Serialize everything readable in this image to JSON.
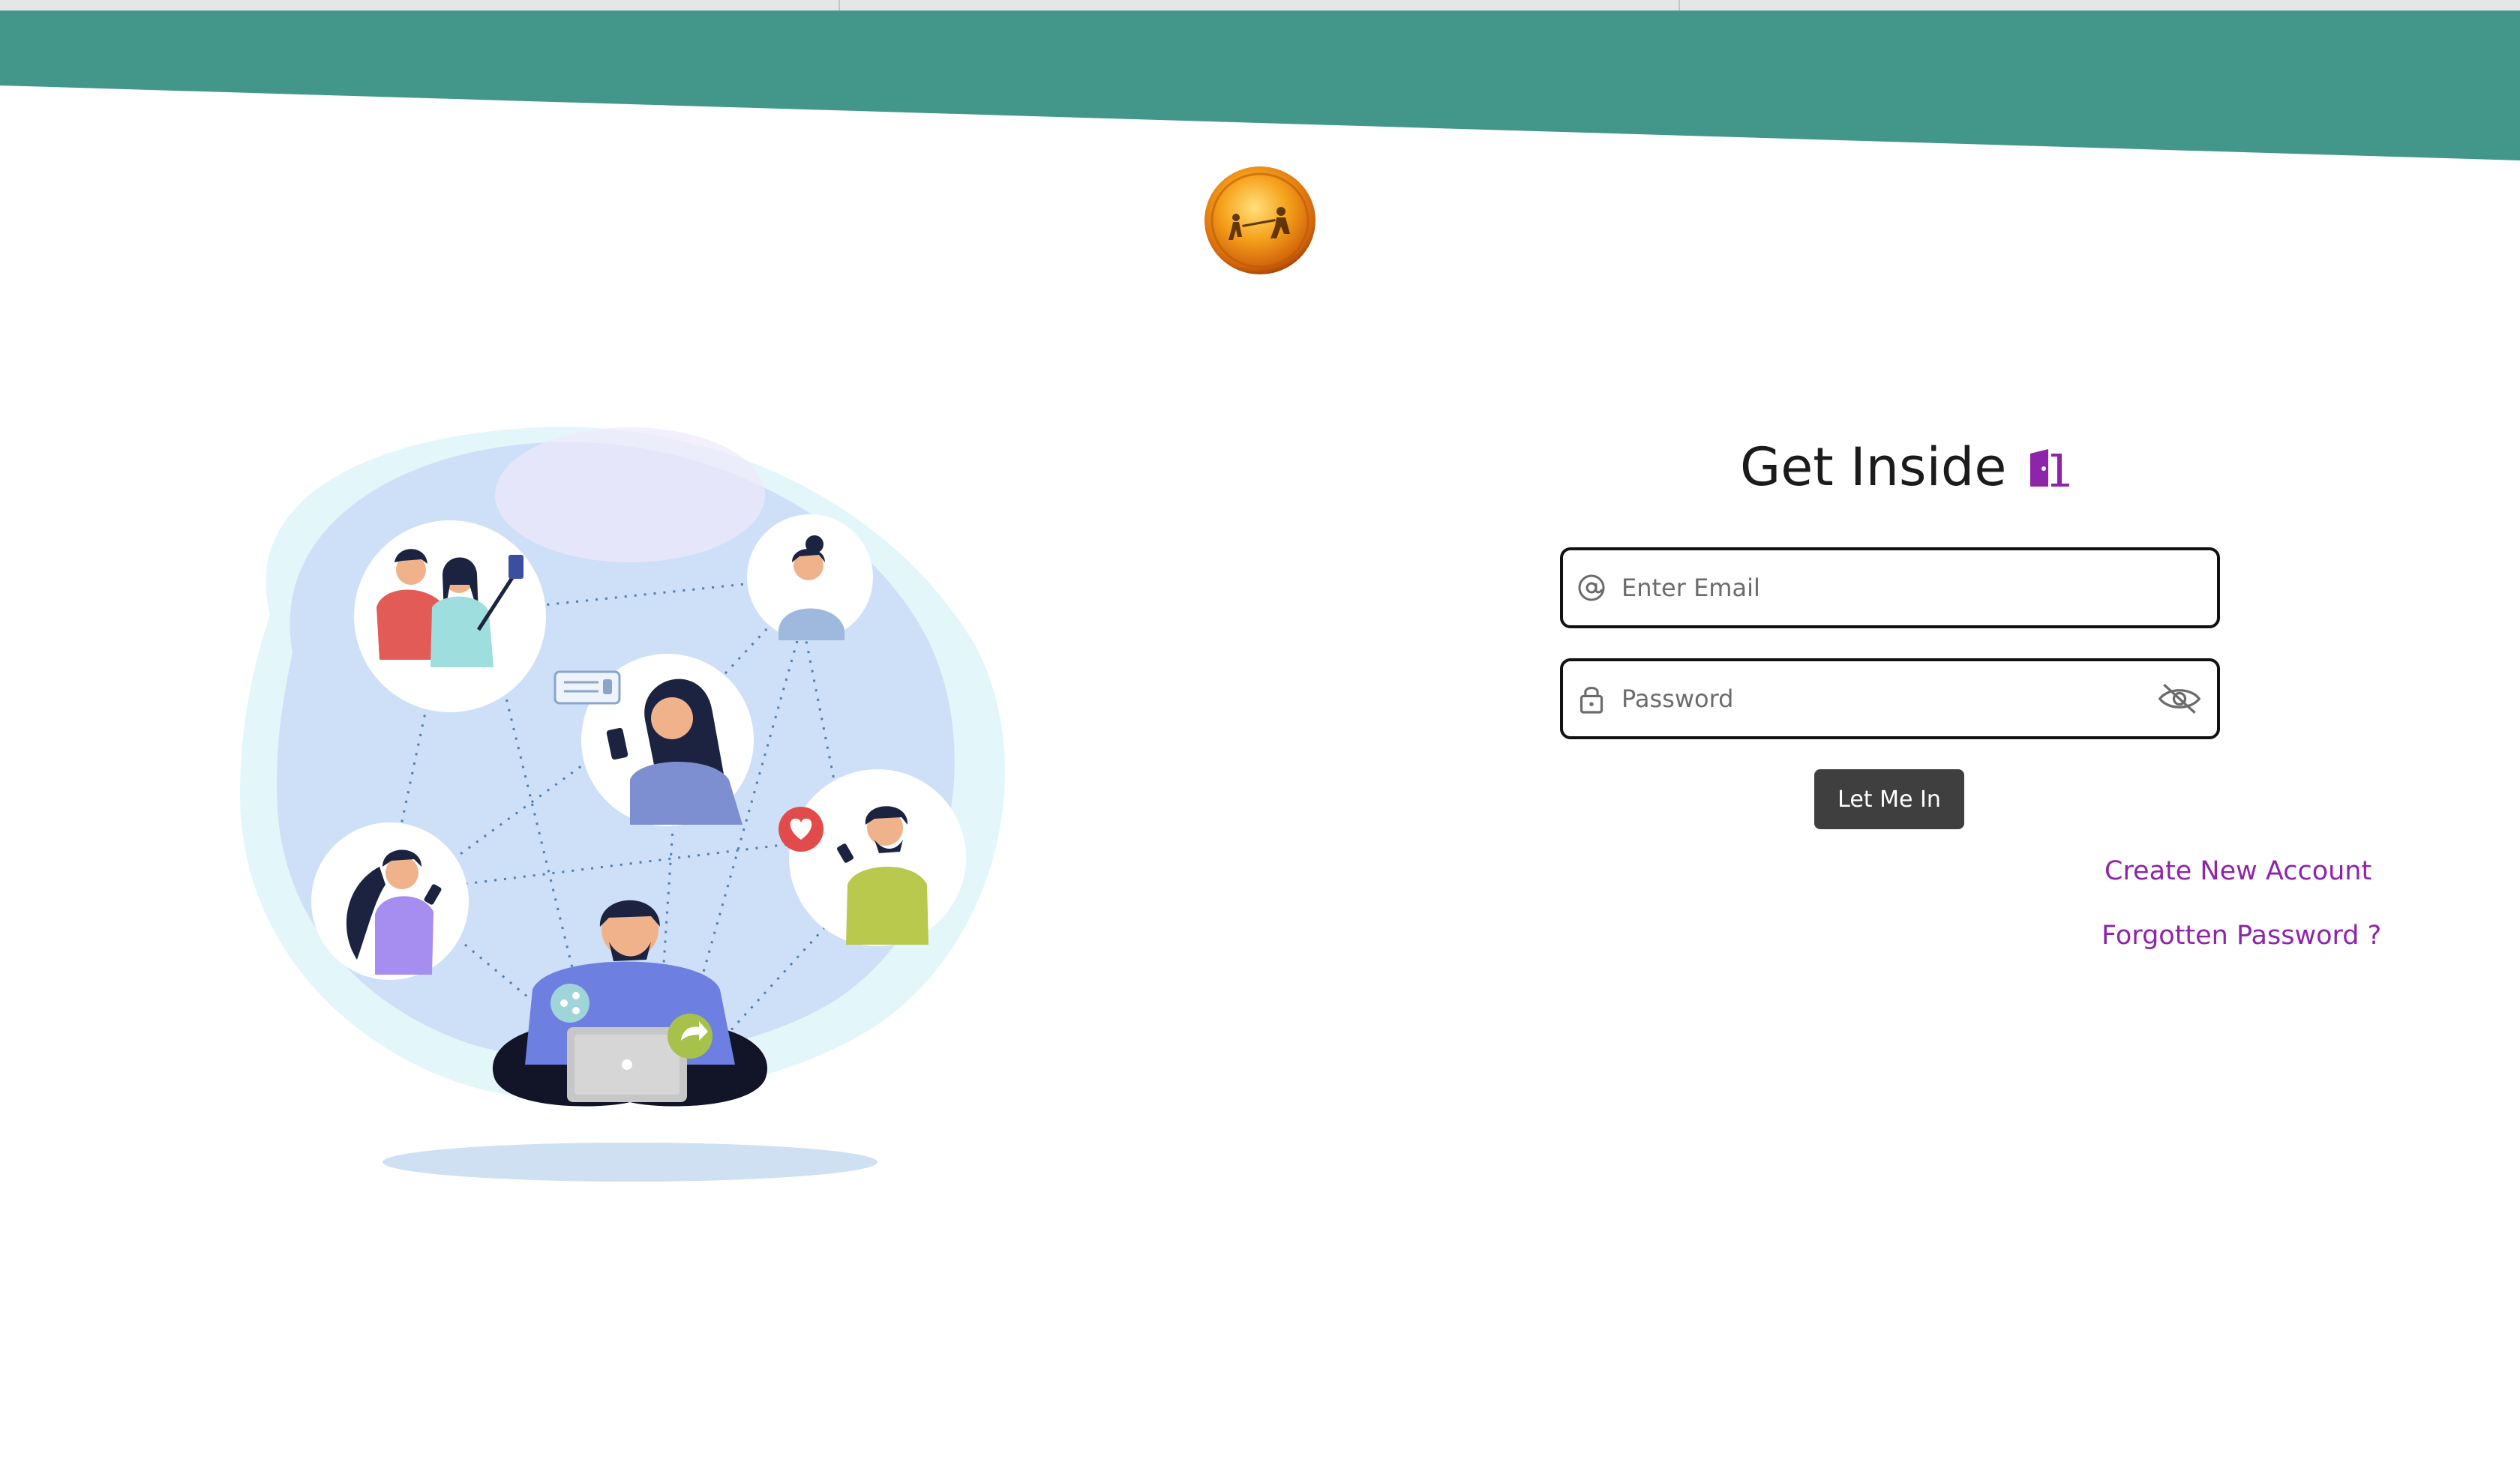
{
  "colors": {
    "header_band": "#42968a",
    "link": "#8e24aa",
    "button_bg": "#3f3f3f",
    "door_icon": "#8e24aa",
    "coin": "#f39c12"
  },
  "logo": {
    "icon": "coin-emblem-icon"
  },
  "illustration": {
    "icon": "social-network-illustration"
  },
  "login": {
    "title": "Get Inside",
    "title_icon": "door-icon",
    "email": {
      "placeholder": "Enter Email",
      "value": "",
      "icon": "at-sign-icon"
    },
    "password": {
      "placeholder": "Password",
      "value": "",
      "icon": "lock-icon",
      "toggle_icon": "eye-off-icon"
    },
    "submit_label": "Let Me In",
    "create_account_label": "Create New Account",
    "forgot_password_label": "Forgotten Password ?"
  }
}
